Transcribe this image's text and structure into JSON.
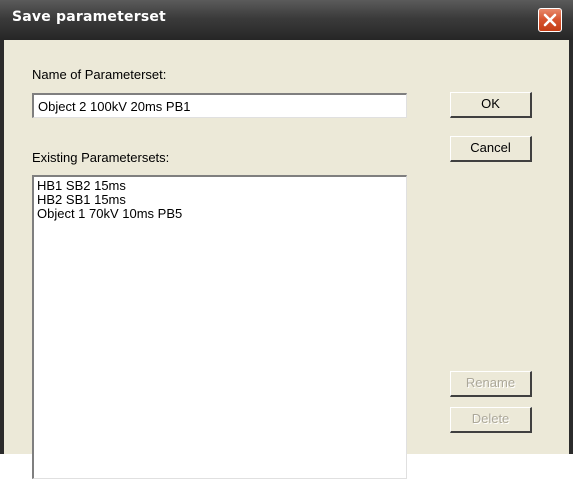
{
  "window": {
    "title": "Save parameterset"
  },
  "form": {
    "name_label": "Name of Parameterset:",
    "name_value": "Object 2 100kV 20ms PB1",
    "existing_label": "Existing Parametersets:",
    "existing_items": [
      "HB1 SB2 15ms",
      "HB2 SB1 15ms",
      "Object 1 70kV 10ms PB5"
    ]
  },
  "buttons": {
    "ok": "OK",
    "cancel": "Cancel",
    "rename": "Rename",
    "delete": "Delete"
  },
  "colors": {
    "title_bar": "#3b3b3b",
    "close_button": "#d6532e",
    "dialog_face": "#ece9d8",
    "disabled_text": "#aca899"
  },
  "icons": {
    "close": "close-icon"
  }
}
